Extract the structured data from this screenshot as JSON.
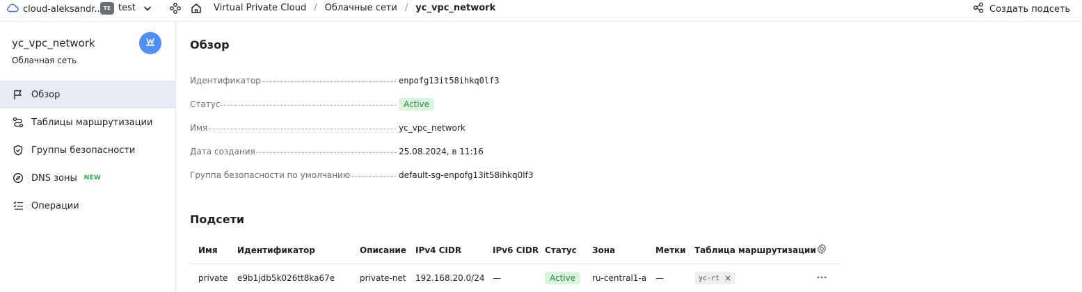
{
  "topbar": {
    "cloud_name": "cloud-aleksandr...",
    "folder_badge": "TE",
    "folder_name": "test",
    "breadcrumbs": [
      "Virtual Private Cloud",
      "Облачные сети",
      "yc_vpc_network"
    ],
    "create_subnet_label": "Создать подсеть"
  },
  "sidebar": {
    "title": "yc_vpc_network",
    "subtitle": "Облачная сеть",
    "items": [
      {
        "label": "Обзор",
        "icon": "flag-icon",
        "active": true
      },
      {
        "label": "Таблицы маршрутизации",
        "icon": "route-icon"
      },
      {
        "label": "Группы безопасности",
        "icon": "shield-icon"
      },
      {
        "label": "DNS зоны",
        "icon": "compass-icon",
        "badge": "NEW"
      },
      {
        "label": "Операции",
        "icon": "list-check-icon"
      }
    ]
  },
  "overview": {
    "heading": "Обзор",
    "properties": [
      {
        "label": "Идентификатор",
        "value": "enpofg13it58ihkq0lf3"
      },
      {
        "label": "Статус",
        "value": "Active"
      },
      {
        "label": "Имя",
        "value": "yc_vpc_network"
      },
      {
        "label": "Дата создания",
        "value": "25.08.2024, в 11:16"
      },
      {
        "label": "Группа безопасности по умолчанию",
        "value": "default-sg-enpofg13it58ihkq0lf3"
      }
    ]
  },
  "subnets": {
    "heading": "Подсети",
    "columns": [
      "Имя",
      "Идентификатор",
      "Описание",
      "IPv4 CIDR",
      "IPv6 CIDR",
      "Статус",
      "Зона",
      "Метки",
      "Таблица маршрутизации"
    ],
    "rows": [
      {
        "name": "private",
        "id": "e9b1jdb5k026tt8ka67e",
        "description": "private-net",
        "ipv4": "192.168.20.0/24",
        "ipv6": "—",
        "status": "Active",
        "zone": "ru-central1-a",
        "labels": "—",
        "route_table": "yc-rt",
        "remove_glyph": "×"
      }
    ]
  },
  "colors": {
    "accent": "#4f8ef7",
    "link": "#3d6fd9",
    "active_nav_bg": "#e7ebf6",
    "status_bg": "#dcf3de",
    "status_text": "#2c8a3f",
    "new_badge": "#2faa4b"
  }
}
